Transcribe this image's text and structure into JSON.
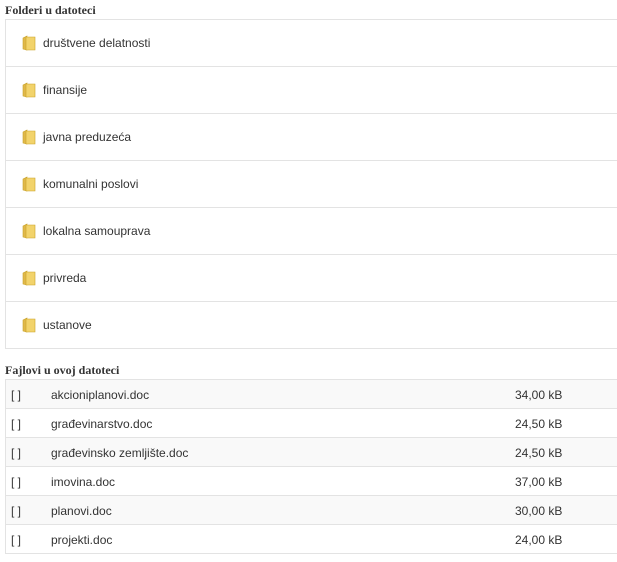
{
  "folders_section": {
    "title": "Folderi u datoteci",
    "items": [
      {
        "label": "društvene delatnosti"
      },
      {
        "label": "finansije"
      },
      {
        "label": "javna preduzeća"
      },
      {
        "label": "komunalni poslovi"
      },
      {
        "label": "lokalna samouprava"
      },
      {
        "label": "privreda"
      },
      {
        "label": "ustanove"
      }
    ],
    "icon": "folder-icon",
    "colors": {
      "folder_fill": "#f2d36b",
      "folder_edge": "#c9a227"
    }
  },
  "files_section": {
    "title": "Fajlovi u ovoj datoteci",
    "rows": [
      {
        "icon_text": "[ ]",
        "name": "akcioniplanovi.doc",
        "size": "34,00 kB"
      },
      {
        "icon_text": "[ ]",
        "name": "građevinarstvo.doc",
        "size": "24,50 kB"
      },
      {
        "icon_text": "[ ]",
        "name": "građevinsko zemljište.doc",
        "size": "24,50 kB"
      },
      {
        "icon_text": "[ ]",
        "name": "imovina.doc",
        "size": "37,00 kB"
      },
      {
        "icon_text": "[ ]",
        "name": "planovi.doc",
        "size": "30,00 kB"
      },
      {
        "icon_text": "[ ]",
        "name": "projekti.doc",
        "size": "24,00 kB"
      }
    ]
  }
}
